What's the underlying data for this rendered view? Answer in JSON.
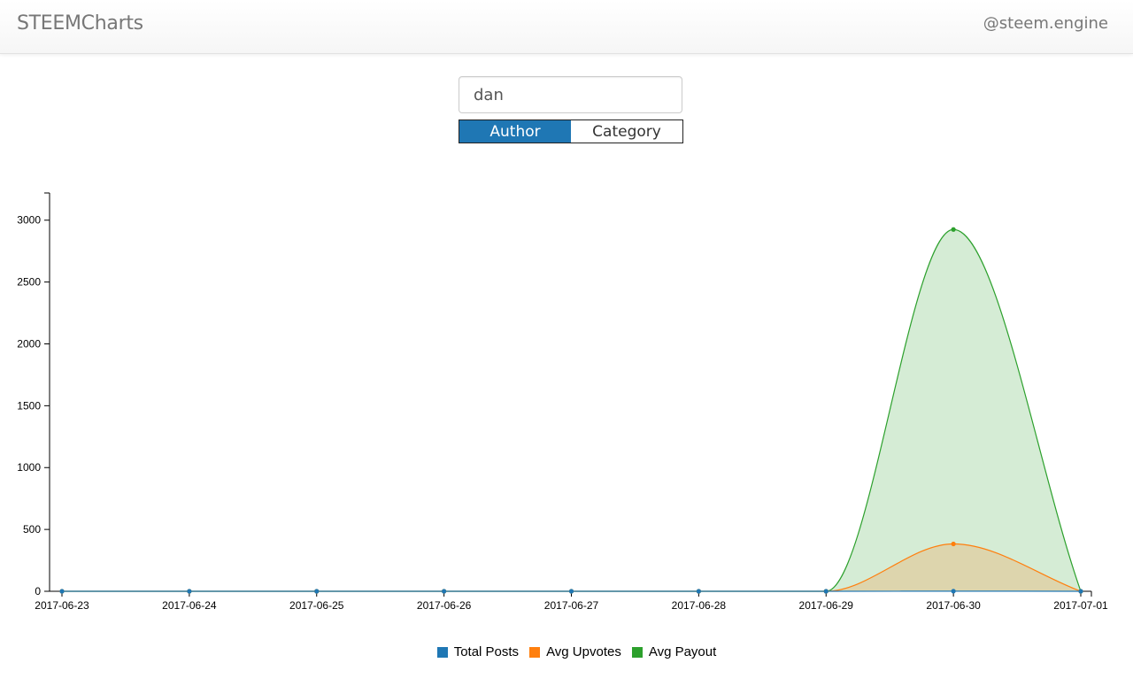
{
  "navbar": {
    "brand": "STEEMCharts",
    "right_link": "@steem.engine"
  },
  "search": {
    "value": "dan"
  },
  "toggle": {
    "options": [
      "Author",
      "Category"
    ],
    "active": "Author"
  },
  "chart_data": {
    "type": "area",
    "x": [
      "2017-06-23",
      "2017-06-24",
      "2017-06-25",
      "2017-06-26",
      "2017-06-27",
      "2017-06-28",
      "2017-06-29",
      "2017-06-30",
      "2017-07-01"
    ],
    "yticks": [
      0,
      500,
      1000,
      1500,
      2000,
      2500,
      3000
    ],
    "ylim": [
      0,
      3220
    ],
    "series": [
      {
        "name": "Total Posts",
        "color": "#1f77b4",
        "values": [
          0,
          0,
          0,
          0,
          0,
          0,
          0,
          1,
          0
        ]
      },
      {
        "name": "Avg Upvotes",
        "color": "#ff7f0e",
        "values": [
          0,
          0,
          0,
          0,
          0,
          0,
          0,
          383,
          0
        ]
      },
      {
        "name": "Avg Payout",
        "color": "#2ca02c",
        "values": [
          0,
          0,
          0,
          0,
          0,
          0,
          0,
          2925,
          0
        ]
      }
    ],
    "legend_position": "bottom-center"
  }
}
